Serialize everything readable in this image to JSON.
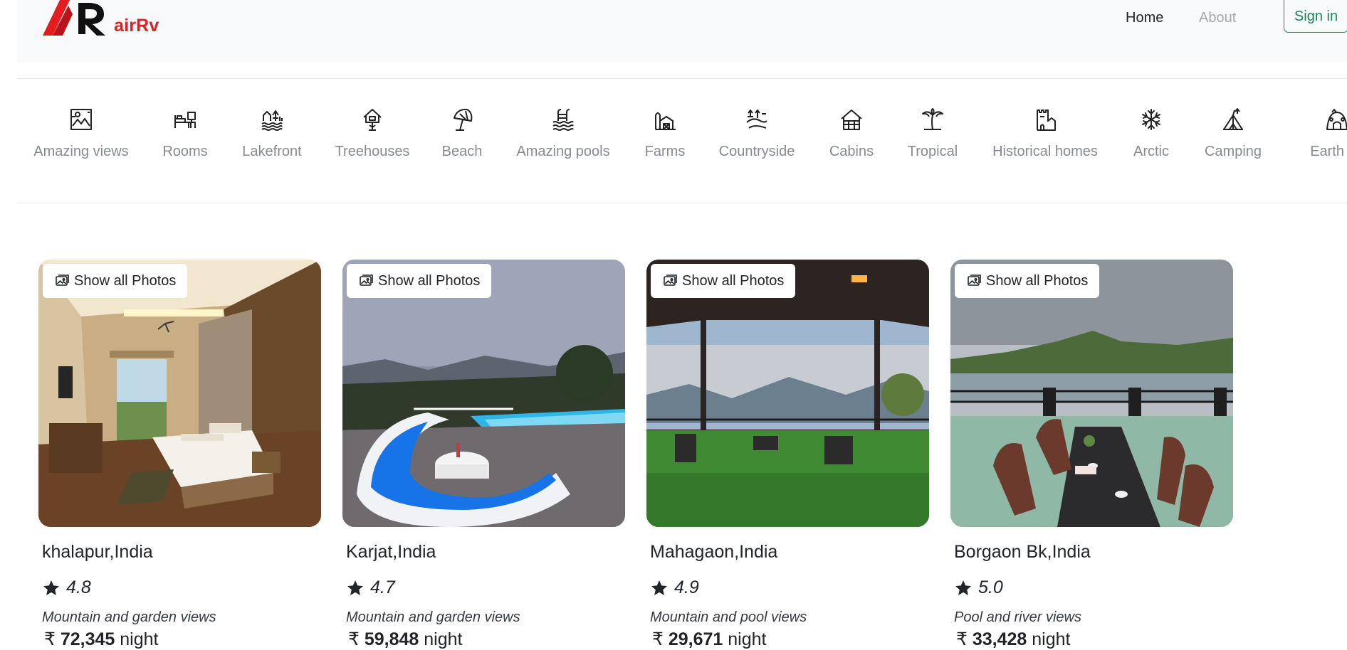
{
  "header": {
    "brand": "airRv",
    "nav": {
      "home": "Home",
      "about": "About"
    },
    "signin_label": "Sign in"
  },
  "categories": [
    {
      "label": "Amazing views",
      "icon": "amazing-views-icon"
    },
    {
      "label": "Rooms",
      "icon": "rooms-icon"
    },
    {
      "label": "Lakefront",
      "icon": "lakefront-icon"
    },
    {
      "label": "Treehouses",
      "icon": "treehouse-icon"
    },
    {
      "label": "Beach",
      "icon": "beach-umbrella-icon"
    },
    {
      "label": "Amazing pools",
      "icon": "pool-icon"
    },
    {
      "label": "Farms",
      "icon": "farm-icon"
    },
    {
      "label": "Countryside",
      "icon": "countryside-icon"
    },
    {
      "label": "Cabins",
      "icon": "cabin-icon"
    },
    {
      "label": "Tropical",
      "icon": "palm-tree-icon"
    },
    {
      "label": "Historical homes",
      "icon": "castle-icon"
    },
    {
      "label": "Arctic",
      "icon": "snowflake-icon"
    },
    {
      "label": "Camping",
      "icon": "tent-icon"
    },
    {
      "label": "Earth ho",
      "icon": "earth-home-icon"
    }
  ],
  "listings": [
    {
      "photo_button": "Show all Photos",
      "title": "khalapur,India",
      "rating": "4.8",
      "description": "Mountain and garden views",
      "currency": "₹",
      "price": "72,345",
      "per": "night"
    },
    {
      "photo_button": "Show all Photos",
      "title": "Karjat,India",
      "rating": "4.7",
      "description": "Mountain and garden views",
      "currency": "₹",
      "price": "59,848",
      "per": "night"
    },
    {
      "photo_button": "Show all Photos",
      "title": "Mahagaon,India",
      "rating": "4.9",
      "description": "Mountain and pool views",
      "currency": "₹",
      "price": "29,671",
      "per": "night"
    },
    {
      "photo_button": "Show all Photos",
      "title": "Borgaon Bk,India",
      "rating": "5.0",
      "description": "Pool and river views",
      "currency": "₹",
      "price": "33,428",
      "per": "night"
    }
  ],
  "colors": {
    "brand": "#e41d21",
    "signin_accent": "#198754",
    "header_bg": "#f8f9fa",
    "category_text": "#858b91"
  }
}
